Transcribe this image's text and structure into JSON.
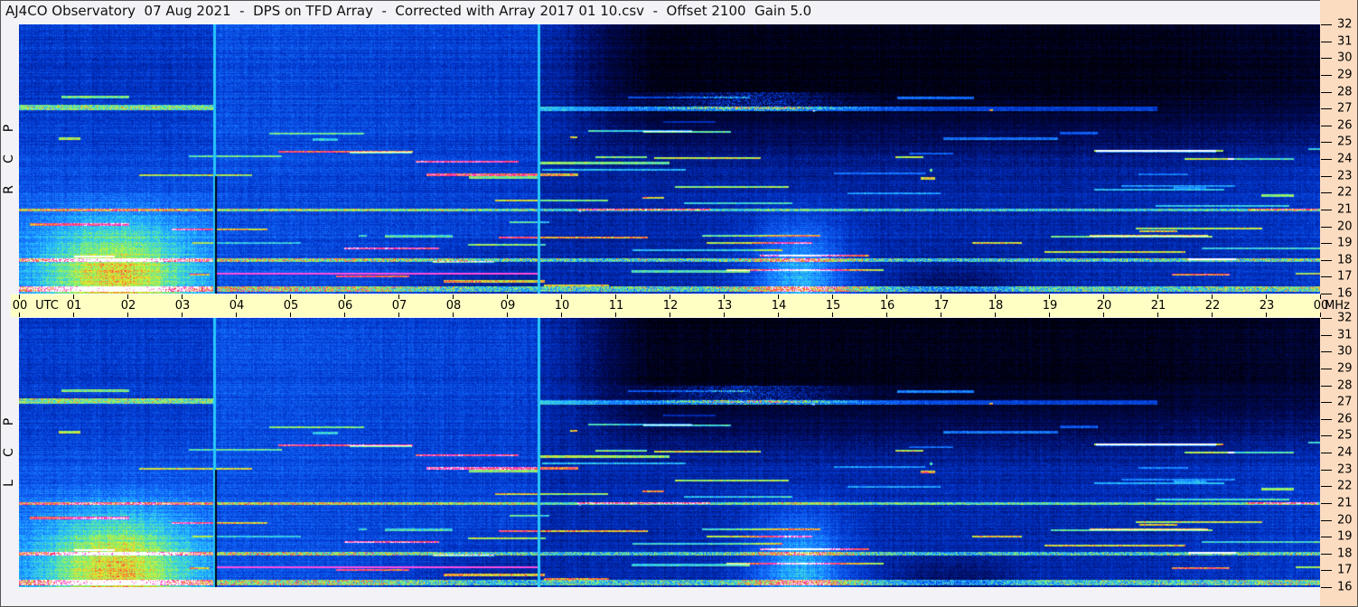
{
  "title": "AJ4CO Observatory  07 Aug 2021  -  DPS on TFD Array  -  Corrected with Array 2017 01 10.csv  -  Offset 2100  Gain 5.0",
  "chart_data": {
    "type": "heatmap",
    "title": "AJ4CO Observatory  07 Aug 2021  -  DPS on TFD Array  -  Corrected with Array 2017 01 10.csv  -  Offset 2100  Gain 5.0",
    "xlabel": "UTC",
    "ylabel": "MHz",
    "x_range": [
      0,
      24
    ],
    "y_range": [
      16,
      32
    ],
    "x_ticks": [
      "00",
      "01",
      "02",
      "03",
      "04",
      "05",
      "06",
      "07",
      "08",
      "09",
      "10",
      "11",
      "12",
      "13",
      "14",
      "15",
      "16",
      "17",
      "18",
      "19",
      "20",
      "21",
      "22",
      "23",
      "00"
    ],
    "y_ticks": [
      16,
      17,
      18,
      19,
      20,
      21,
      22,
      23,
      24,
      25,
      26,
      27,
      28,
      29,
      30,
      31,
      32
    ],
    "panels": [
      {
        "name": "RCP",
        "letters": [
          "R",
          "C",
          "P"
        ]
      },
      {
        "name": "LCP",
        "letters": [
          "L",
          "C",
          "P"
        ]
      }
    ],
    "annotations": {
      "utc_label": "UTC",
      "mhz_label": "MHz"
    },
    "vertical_markers_utc": [
      3.6,
      9.58
    ],
    "bright_bands_mhz": [
      27,
      21,
      18,
      17.2
    ]
  }
}
